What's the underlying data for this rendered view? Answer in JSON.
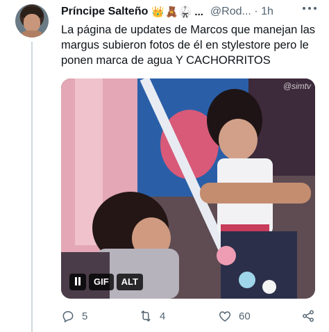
{
  "tweet": {
    "display_name": "Príncipe Salteño",
    "emojis": "👑🧸🥋",
    "name_truncation": "...",
    "handle_time": "@Rod... · 1h",
    "text": "La página de updates de Marcos que manejan las margus subieron fotos de él en stylestore pero le ponen marca de agua Y CACHORRITOS"
  },
  "media": {
    "watermark": "@simtv",
    "gif_label": "GIF",
    "alt_label": "ALT"
  },
  "actions": {
    "replies": "5",
    "retweets": "4",
    "likes": "60"
  },
  "icons": [
    "avatar",
    "more-icon",
    "pause-icon",
    "reply-icon",
    "retweet-icon",
    "like-icon",
    "share-icon"
  ]
}
